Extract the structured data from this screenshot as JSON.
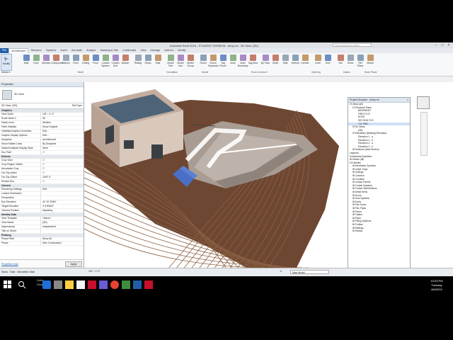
{
  "title": "Autodesk Revit 2016 - STUDENT VERSION -    temp.rvt - 3D View: {3D}",
  "search_placeholder": "Type a keyword or phrase",
  "window_controls": [
    "–",
    "□",
    "×"
  ],
  "tabs": [
    "File",
    "Architecture",
    "Structure",
    "Systems",
    "Insert",
    "Annotate",
    "Analyze",
    "Massing & Site",
    "Collaborate",
    "View",
    "Manage",
    "Add-Ins",
    "Modify"
  ],
  "ribbon": {
    "modify": "Modify",
    "select": "Select ▾",
    "build_buttons": [
      "Wall",
      "Door",
      "Window",
      "Component",
      "Column",
      "Roof",
      "Ceiling",
      "Floor",
      "Curtain System",
      "Curtain Grid",
      "Mullion"
    ],
    "circulation_buttons": [
      "Railing",
      "Ramp",
      "Stair"
    ],
    "model_buttons": [
      "Model Text",
      "Model Line",
      "Model Group"
    ],
    "room_buttons": [
      "Room",
      "Room Separator",
      "Tag Room",
      "Area",
      "Area Boundary",
      "Tag Area"
    ],
    "opening_buttons": [
      "By Face",
      "Shaft",
      "Wall",
      "Vertical",
      "Dormer"
    ],
    "datum_buttons": [
      "Level",
      "Grid"
    ],
    "workplane_buttons": [
      "Set",
      "Show",
      "Ref Plane",
      "Viewer"
    ],
    "panels": [
      "Build",
      "Circulation",
      "Model",
      "Room & Area ▾",
      "Opening",
      "Datum",
      "Work Plane"
    ]
  },
  "properties": {
    "header": "Properties",
    "type_name": "3D View",
    "selector": "3D View: {3D}",
    "edit_type": "Edit Type",
    "groups": [
      {
        "name": "Graphics",
        "rows": [
          [
            "View Scale",
            "1/8\" = 1'-0\""
          ],
          [
            "Scale Value 1:",
            "96"
          ],
          [
            "Detail Level",
            "Medium"
          ],
          [
            "Parts Visibility",
            "Show Original"
          ],
          [
            "Visibility/Graphics Overrides",
            "Edit..."
          ],
          [
            "Graphic Display Options",
            "Edit..."
          ],
          [
            "Discipline",
            "Architectural"
          ],
          [
            "Show Hidden Lines",
            "By Discipline"
          ],
          [
            "Default Analysis Display Style",
            "None"
          ],
          [
            "Sun Path",
            "☐"
          ]
        ]
      },
      {
        "name": "Extents",
        "rows": [
          [
            "Crop View",
            "☐"
          ],
          [
            "Crop Region Visible",
            "☐"
          ],
          [
            "Annotation Crop",
            "☐"
          ],
          [
            "Far Clip Active",
            "☐"
          ],
          [
            "Far Clip Offset",
            "1000' 0\""
          ],
          [
            "Section Box",
            "☐"
          ]
        ]
      },
      {
        "name": "Camera",
        "rows": [
          [
            "Rendering Settings",
            "Edit..."
          ],
          [
            "Locked Orientation",
            ""
          ],
          [
            "Perspective",
            ""
          ],
          [
            "Eye Elevation",
            "44' 10 33/64\""
          ],
          [
            "Target Elevation",
            "4' 8 59/64\""
          ],
          [
            "Camera Position",
            "Adjusting"
          ]
        ]
      },
      {
        "name": "Identity Data",
        "rows": [
          [
            "View Template",
            "<None>"
          ],
          [
            "View Name",
            "{3D}"
          ],
          [
            "Dependency",
            "Independent"
          ],
          [
            "Title on Sheet",
            ""
          ]
        ]
      },
      {
        "name": "Phasing",
        "rows": [
          [
            "Phase Filter",
            "Show All"
          ],
          [
            "Phase",
            "New Construction"
          ]
        ]
      }
    ],
    "help_link": "Properties help",
    "apply": "Apply"
  },
  "browser": {
    "title": "Project Browser - temp.rvt",
    "items": [
      {
        "label": "⊟ Views (all)",
        "indent": 0
      },
      {
        "label": "⊟ Structural Plans",
        "indent": 1
      },
      {
        "label": "BASEMENT",
        "indent": 3
      },
      {
        "label": "FIRST FLR.",
        "indent": 3
      },
      {
        "label": "ROOF",
        "indent": 3
      },
      {
        "label": "SECOND FLR.",
        "indent": 3
      },
      {
        "label": "T.O. FND",
        "indent": 3,
        "selected": true
      },
      {
        "label": "⊟ 3D Views",
        "indent": 1
      },
      {
        "label": "{3D}",
        "indent": 3
      },
      {
        "label": "⊟ Elevations (Building Elevation)",
        "indent": 1
      },
      {
        "label": "Elevation 1 - a",
        "indent": 3
      },
      {
        "label": "Elevation 1 - b",
        "indent": 3
      },
      {
        "label": "Elevation 2 - a",
        "indent": 3
      },
      {
        "label": "Elevation 2 - b",
        "indent": 3
      },
      {
        "label": "⊞ Sections (Wall Section)",
        "indent": 1
      },
      {
        "label": "Legends",
        "indent": 0
      },
      {
        "label": "Schedules/Quantities",
        "indent": 0
      },
      {
        "label": "⊞ Sheets (all)",
        "indent": 0
      },
      {
        "label": "⊟ Families",
        "indent": 0
      },
      {
        "label": "⊞ Annotation Symbols",
        "indent": 1
      },
      {
        "label": "⊞ Cable Trays",
        "indent": 1
      },
      {
        "label": "⊞ Ceilings",
        "indent": 1
      },
      {
        "label": "⊞ Columns",
        "indent": 1
      },
      {
        "label": "⊞ Conduits",
        "indent": 1
      },
      {
        "label": "⊞ Curtain Panels",
        "indent": 1
      },
      {
        "label": "⊞ Curtain Systems",
        "indent": 1
      },
      {
        "label": "⊞ Curtain Wall Mullions",
        "indent": 1
      },
      {
        "label": "⊞ Detail Items",
        "indent": 1
      },
      {
        "label": "⊞ Doors",
        "indent": 1
      },
      {
        "label": "⊞ Duct Systems",
        "indent": 1
      },
      {
        "label": "⊞ Ducts",
        "indent": 1
      },
      {
        "label": "⊞ Flex Ducts",
        "indent": 1
      },
      {
        "label": "⊞ Flex Pipes",
        "indent": 1
      },
      {
        "label": "⊞ Floors",
        "indent": 1
      },
      {
        "label": "⊞ Pattern",
        "indent": 1
      },
      {
        "label": "⊞ Pipes",
        "indent": 1
      },
      {
        "label": "⊞ Piping Systems",
        "indent": 1
      },
      {
        "label": "⊞ Profiles",
        "indent": 1
      },
      {
        "label": "⊞ Railings",
        "indent": 1
      },
      {
        "label": "⊞ Ramps",
        "indent": 1
      }
    ]
  },
  "status": {
    "text": "Stairs : Stair : Monolithic Stair",
    "view_controls": "1/8\" = 1'-0\"",
    "model": "Main Model",
    "zero": ":0"
  },
  "taskbar": {
    "notify_line1": "Links",
    "notify_line2": "Google",
    "time": "10:03 PM",
    "day": "Tuesday",
    "date": "8/6/2019"
  },
  "colors": {
    "terrain": "#6e4733",
    "terrain_line": "#8c6244",
    "building_wall": "#d9c9bd",
    "roof": "#4d6478",
    "accent": "#1f5fa8"
  }
}
